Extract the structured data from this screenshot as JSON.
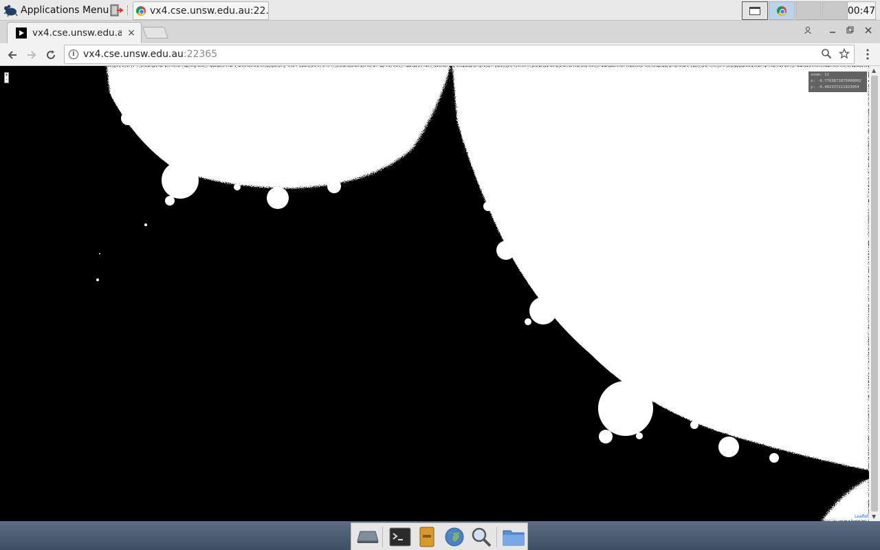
{
  "panel": {
    "apps_menu_label": "Applications Menu",
    "task_title": "vx4.cse.unsw.edu.au:22...",
    "clock": "00:47"
  },
  "browser": {
    "tab_title": "vx4.cse.unsw.edu.au",
    "tab_close": "×",
    "url_host": "vx4.cse.unsw.edu.au",
    "url_port": ":22365",
    "icons": [
      "back-icon",
      "forward-icon",
      "reload-icon",
      "info-icon",
      "zoom-icon",
      "star-icon",
      "menu-icon",
      "profile-icon",
      "minimize-icon",
      "maximize-icon",
      "close-icon"
    ]
  },
  "map": {
    "coords": {
      "zoom": "zoom: 12",
      "x": "x: -0.7763671875000002",
      "y": "y: -0.402337211023954"
    },
    "zoom_control": "+ -",
    "attribution": "Leaflet"
  },
  "dock": {
    "items": [
      "desktop-icon",
      "terminal-icon",
      "file-manager-icon",
      "web-browser-icon",
      "search-icon",
      "folder-icon"
    ]
  },
  "colors": {
    "set_interior": "#000000",
    "background": "#ffffff",
    "panel": "#e9e9e9",
    "dock_gradient_top": "#5b6d83"
  }
}
